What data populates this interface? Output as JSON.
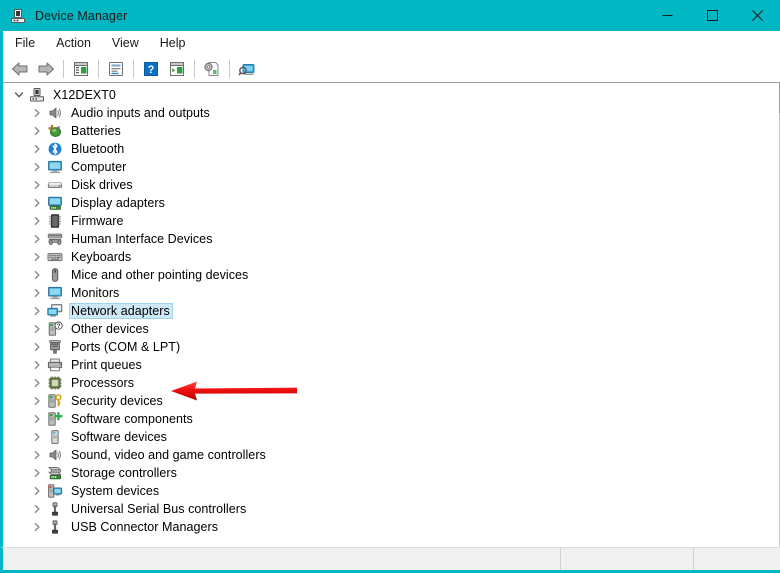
{
  "window": {
    "title": "Device Manager",
    "icon": "device-manager-icon",
    "accent_color": "#00b7c3",
    "controls": [
      {
        "name": "minimize-button",
        "glyph": "minimize-icon"
      },
      {
        "name": "maximize-button",
        "glyph": "maximize-icon"
      },
      {
        "name": "close-button",
        "glyph": "close-icon"
      }
    ]
  },
  "menubar": {
    "items": [
      {
        "label": "File"
      },
      {
        "label": "Action"
      },
      {
        "label": "View"
      },
      {
        "label": "Help"
      }
    ]
  },
  "toolbar": {
    "buttons": [
      {
        "name": "back-button",
        "icon": "back-arrow-icon"
      },
      {
        "name": "forward-button",
        "icon": "forward-arrow-icon"
      },
      {
        "name": "separator",
        "icon": "separator"
      },
      {
        "name": "show-hide-console-tree-button",
        "icon": "console-tree-icon"
      },
      {
        "name": "separator",
        "icon": "separator"
      },
      {
        "name": "properties-button",
        "icon": "properties-icon"
      },
      {
        "name": "separator",
        "icon": "separator"
      },
      {
        "name": "help-button",
        "icon": "help-question-icon"
      },
      {
        "name": "show-hide-action-pane-button",
        "icon": "action-pane-icon"
      },
      {
        "name": "separator",
        "icon": "separator"
      },
      {
        "name": "update-driver-button",
        "icon": "update-driver-icon"
      },
      {
        "name": "separator",
        "icon": "separator"
      },
      {
        "name": "scan-hardware-changes-button",
        "icon": "scan-hardware-icon"
      }
    ]
  },
  "tree": {
    "root": {
      "label": "X12DEXT0",
      "icon": "computer-root-icon",
      "expanded": true
    },
    "items": [
      {
        "label": "Audio inputs and outputs",
        "icon": "speaker-icon"
      },
      {
        "label": "Batteries",
        "icon": "battery-icon"
      },
      {
        "label": "Bluetooth",
        "icon": "bluetooth-icon"
      },
      {
        "label": "Computer",
        "icon": "monitor-icon"
      },
      {
        "label": "Disk drives",
        "icon": "disk-drive-icon"
      },
      {
        "label": "Display adapters",
        "icon": "display-adapter-icon"
      },
      {
        "label": "Firmware",
        "icon": "firmware-chip-icon"
      },
      {
        "label": "Human Interface Devices",
        "icon": "hid-gamepad-icon"
      },
      {
        "label": "Keyboards",
        "icon": "keyboard-icon"
      },
      {
        "label": "Mice and other pointing devices",
        "icon": "mouse-icon"
      },
      {
        "label": "Monitors",
        "icon": "monitor-icon"
      },
      {
        "label": "Network adapters",
        "icon": "network-adapter-icon",
        "selected": true
      },
      {
        "label": "Other devices",
        "icon": "unknown-device-icon"
      },
      {
        "label": "Ports (COM & LPT)",
        "icon": "port-icon"
      },
      {
        "label": "Print queues",
        "icon": "printer-icon"
      },
      {
        "label": "Processors",
        "icon": "processor-icon"
      },
      {
        "label": "Security devices",
        "icon": "security-key-icon"
      },
      {
        "label": "Software components",
        "icon": "software-component-icon"
      },
      {
        "label": "Software devices",
        "icon": "software-device-icon"
      },
      {
        "label": "Sound, video and game controllers",
        "icon": "speaker-icon"
      },
      {
        "label": "Storage controllers",
        "icon": "storage-controller-icon"
      },
      {
        "label": "System devices",
        "icon": "system-device-icon"
      },
      {
        "label": "Universal Serial Bus controllers",
        "icon": "usb-icon"
      },
      {
        "label": "USB Connector Managers",
        "icon": "usb-icon"
      }
    ]
  },
  "annotation": {
    "arrow": {
      "name": "red-arrow-pointer",
      "color": "#e31010",
      "points_to": "Network adapters",
      "direction": "left"
    }
  },
  "statusbar": {
    "main": "",
    "mid": "",
    "right": ""
  }
}
